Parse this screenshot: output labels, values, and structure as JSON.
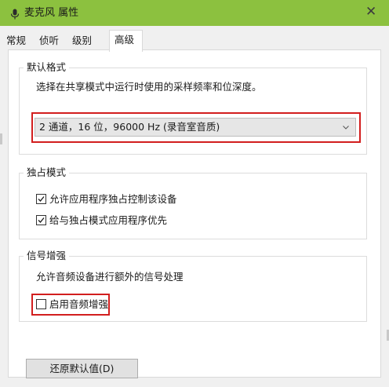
{
  "window": {
    "title": "麦克风 属性",
    "close_glyph": "✕",
    "accent_color": "#8cc13f"
  },
  "tabs": [
    {
      "label": "常规",
      "active": false
    },
    {
      "label": "侦听",
      "active": false
    },
    {
      "label": "级别",
      "active": false
    },
    {
      "label": "高级",
      "active": true
    }
  ],
  "default_format": {
    "group_label": "默认格式",
    "description": "选择在共享模式中运行时使用的采样频率和位深度。",
    "selected_format": "2 通道，16 位，96000 Hz (录音室音质)"
  },
  "exclusive_mode": {
    "group_label": "独占模式",
    "options": [
      {
        "label": "允许应用程序独占控制该设备",
        "checked": true
      },
      {
        "label": "给与独占模式应用程序优先",
        "checked": true
      }
    ]
  },
  "signal_enhancement": {
    "group_label": "信号增强",
    "description": "允许音频设备进行额外的信号处理",
    "option": {
      "label": "启用音频增强",
      "checked": false
    }
  },
  "restore_defaults_label": "还原默认值(D)",
  "highlight_color": "#d21e1e"
}
